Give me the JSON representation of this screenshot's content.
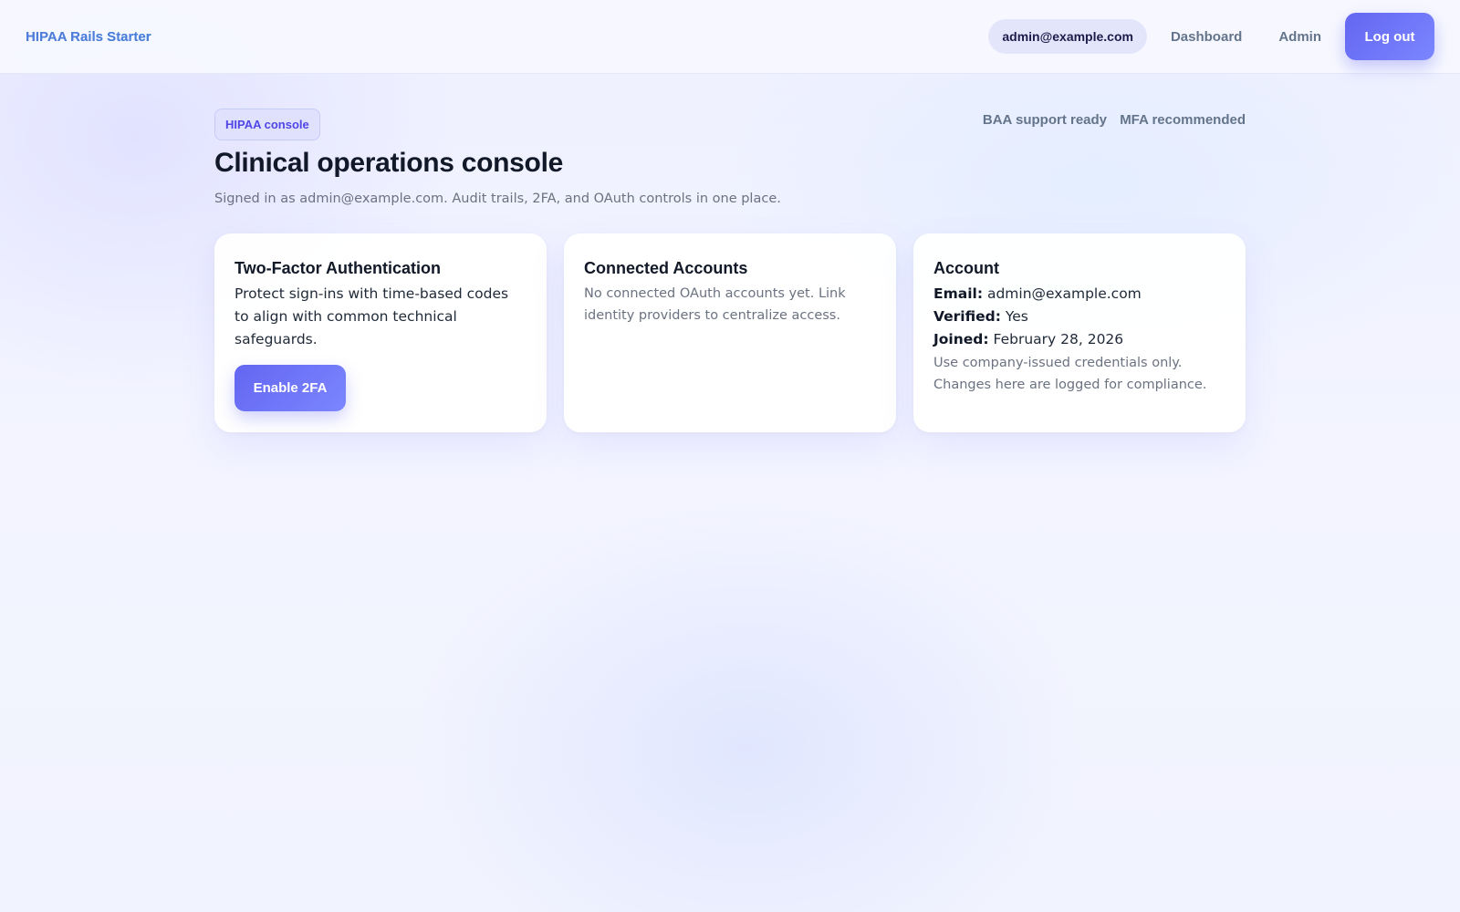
{
  "navbar": {
    "brand": "HIPAA Rails Starter",
    "user_email": "admin@example.com",
    "links": [
      "Dashboard",
      "Admin"
    ],
    "logout_label": "Log out"
  },
  "header": {
    "badge": "HIPAA console",
    "tags": [
      "BAA support ready",
      "MFA recommended"
    ],
    "title": "Clinical operations console",
    "subtitle": "Signed in as admin@example.com. Audit trails, 2FA, and OAuth controls in one place."
  },
  "cards": {
    "two_factor": {
      "title": "Two-Factor Authentication",
      "description": "Protect sign-ins with time-based codes to align with common technical safeguards.",
      "button_label": "Enable 2FA"
    },
    "connected": {
      "title": "Connected Accounts",
      "description": "No connected OAuth accounts yet. Link identity providers to centralize access."
    },
    "account": {
      "title": "Account",
      "email_label": "Email:",
      "email_value": "admin@example.com",
      "verified_label": "Verified:",
      "verified_value": "Yes",
      "joined_label": "Joined:",
      "joined_value": "February 28, 2026",
      "note": "Use company-issued credentials only. Changes here are logged for compliance."
    }
  },
  "colors": {
    "accent": "#6366f1",
    "text": "#111827",
    "muted": "#6b7280"
  }
}
